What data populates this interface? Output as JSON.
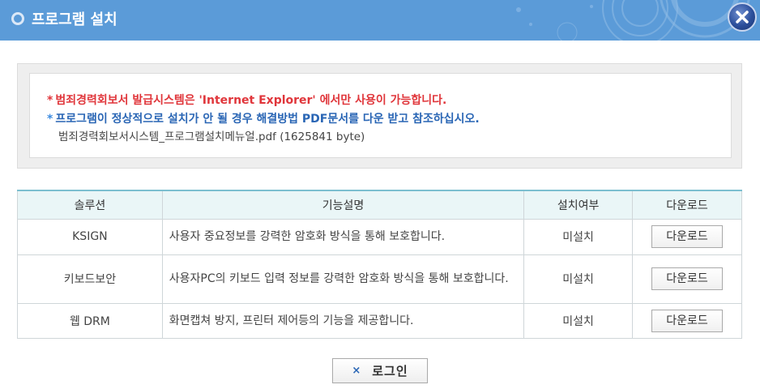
{
  "header": {
    "title": "프로그램 설치",
    "close_icon": "close-icon",
    "bullet_icon": "ring-bullet-icon",
    "color": "#5b9bd8"
  },
  "notice": {
    "line1": "범죄경력회보서 발급시스템은 'Internet Explorer' 에서만 사용이 가능합니다.",
    "line2": "프로그램이 정상적으로 설치가 안 될 경우 해결방법 PDF문서를 다운 받고 참조하십시오.",
    "file_link": "범죄경력회보서시스템_프로그램설치메뉴얼.pdf (1625841 byte)",
    "star": "*",
    "line1_color": "#e0363b",
    "line2_color": "#2a66b5"
  },
  "table": {
    "headers": [
      "솔루션",
      "기능설명",
      "설치여부",
      "다운로드"
    ],
    "rows": [
      {
        "solution": "KSIGN",
        "description": "사용자 중요정보를 강력한 암호화 방식을 통해 보호합니다.",
        "status": "미설치",
        "button": "다운로드"
      },
      {
        "solution": "키보드보안",
        "description": "사용자PC의 키보드 입력 정보를 강력한 암호화 방식을 통해 보호합니다.",
        "status": "미설치",
        "button": "다운로드"
      },
      {
        "solution": "웹 DRM",
        "description": "화면캡쳐 방지, 프린터 제어등의 기능을 제공합니다.",
        "status": "미설치",
        "button": "다운로드"
      }
    ]
  },
  "login": {
    "icon": "×",
    "label": "로그인"
  }
}
